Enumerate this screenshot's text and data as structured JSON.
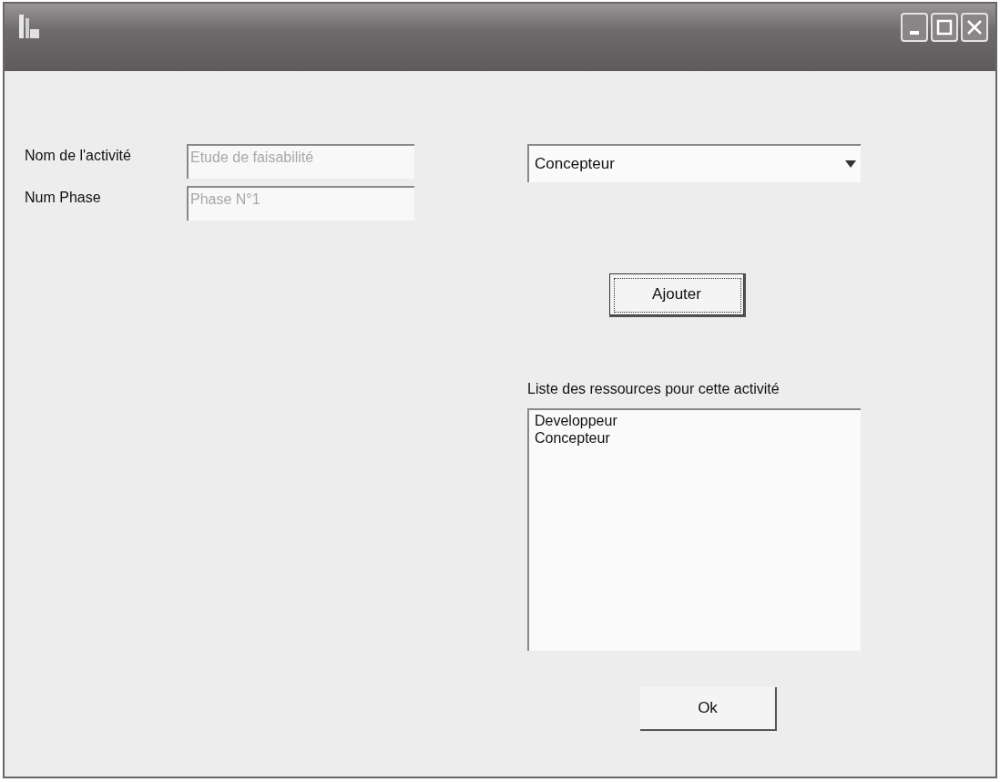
{
  "window": {
    "controls": [
      {
        "kind": "minimize"
      },
      {
        "kind": "maximize"
      },
      {
        "kind": "close"
      }
    ]
  },
  "fields": [
    {
      "label": "Nom de l'activité",
      "value": "Etude de faisabilité",
      "disabled": true
    },
    {
      "label": "Num Phase",
      "value": "Phase N°1",
      "disabled": true
    }
  ],
  "resource_combo": {
    "value": "Concepteur"
  },
  "add_button": {
    "label": "Ajouter",
    "focused": true
  },
  "resource_list": {
    "label": "Liste des ressources pour cette activité",
    "items": [
      "Developpeur",
      "Concepteur"
    ]
  },
  "ok_button": {
    "label": "Ok",
    "focused": false
  }
}
